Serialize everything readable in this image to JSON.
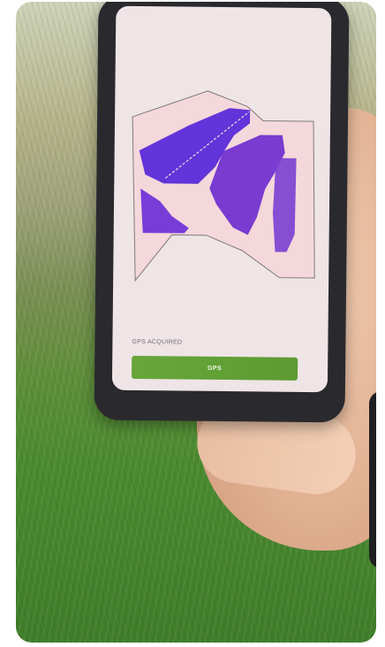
{
  "status": {
    "gps_text": "GPS ACQUIRED"
  },
  "actions": {
    "gps_button_label": "GPS"
  },
  "colors": {
    "accent_green": "#5f9f34",
    "map_purple_dark": "#3f2cd1",
    "map_purple": "#7a2ad1",
    "map_pink": "#efc3c6"
  }
}
